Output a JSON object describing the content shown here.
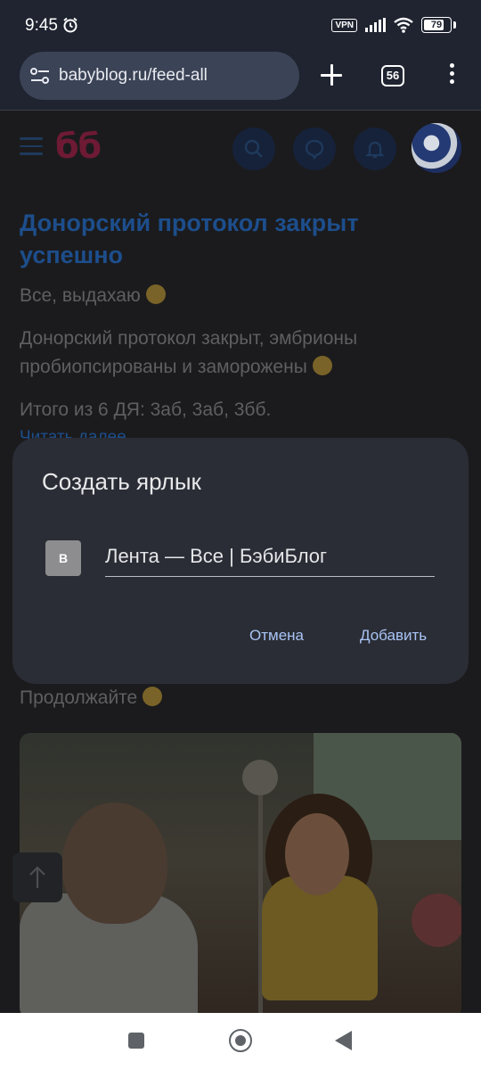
{
  "status_bar": {
    "time": "9:45",
    "vpn_label": "VPN",
    "battery_level": "79",
    "battery_fraction": 0.79
  },
  "browser": {
    "url": "babyblog.ru/feed-all",
    "tabs_count": "56",
    "icons": [
      "site-settings-icon",
      "new-tab-icon",
      "tab-switcher-icon",
      "menu-icon"
    ]
  },
  "site": {
    "logo": "бб",
    "header_icons": [
      "search-icon",
      "chat-icon",
      "bell-icon",
      "avatar"
    ],
    "colors": {
      "logo": "#6e1a35",
      "link": "#1d4e8c"
    }
  },
  "post": {
    "title": "Донорский протокол закрыт успешно",
    "paragraph_1": "Все, выдахаю",
    "paragraph_2": "Донорский протокол закрыт, эмбрионы пробиопсированы и заморожены",
    "paragraph_3": "Итого из 6 ДЯ: 3аб, 3аб, 3бб.",
    "read_more": "Читать далее",
    "continue_text": "Продолжайте"
  },
  "dialog": {
    "title": "Создать ярлык",
    "favicon_letter": "B",
    "shortcut_name": "Лента — Все | БэбиБлог",
    "cancel_label": "Отмена",
    "add_label": "Добавить",
    "accent_color": "#a9c4f5"
  }
}
